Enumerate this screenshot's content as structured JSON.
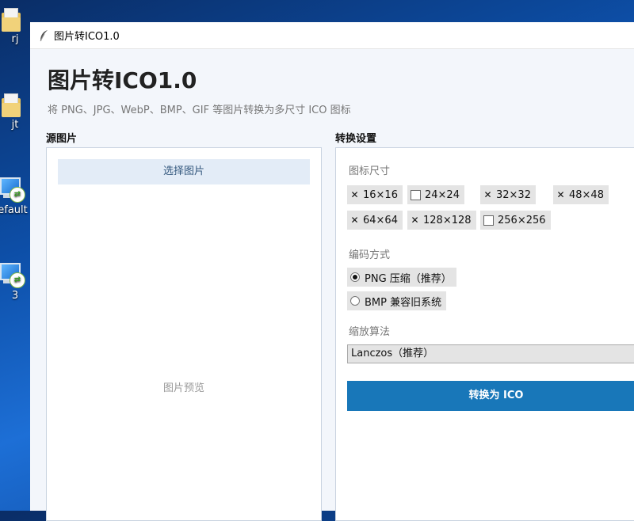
{
  "desktop": {
    "icons": [
      {
        "label": "rj"
      },
      {
        "label": "jt"
      },
      {
        "label": "efault"
      },
      {
        "label": "3"
      }
    ]
  },
  "window": {
    "title": "图片转ICO1.0",
    "app_title": "图片转ICO1.0",
    "subtitle": "将 PNG、JPG、WebP、BMP、GIF 等图片转换为多尺寸 ICO 图标"
  },
  "source": {
    "section_title": "源图片",
    "choose_button": "选择图片",
    "preview_placeholder": "图片预览"
  },
  "settings": {
    "section_title": "转换设置",
    "size_label": "图标尺寸",
    "sizes": [
      {
        "label": "16×16",
        "checked": true
      },
      {
        "label": "24×24",
        "checked": false
      },
      {
        "label": "32×32",
        "checked": true
      },
      {
        "label": "48×48",
        "checked": true
      },
      {
        "label": "64×64",
        "checked": true
      },
      {
        "label": "128×128",
        "checked": true
      },
      {
        "label": "256×256",
        "checked": false
      }
    ],
    "encoding_label": "编码方式",
    "encodings": [
      {
        "label": "PNG 压缩（推荐）",
        "selected": true
      },
      {
        "label": "BMP 兼容旧系统",
        "selected": false
      }
    ],
    "scaling_label": "缩放算法",
    "scaling_value": "Lanczos（推荐）",
    "convert_button": "转换为 ICO"
  }
}
